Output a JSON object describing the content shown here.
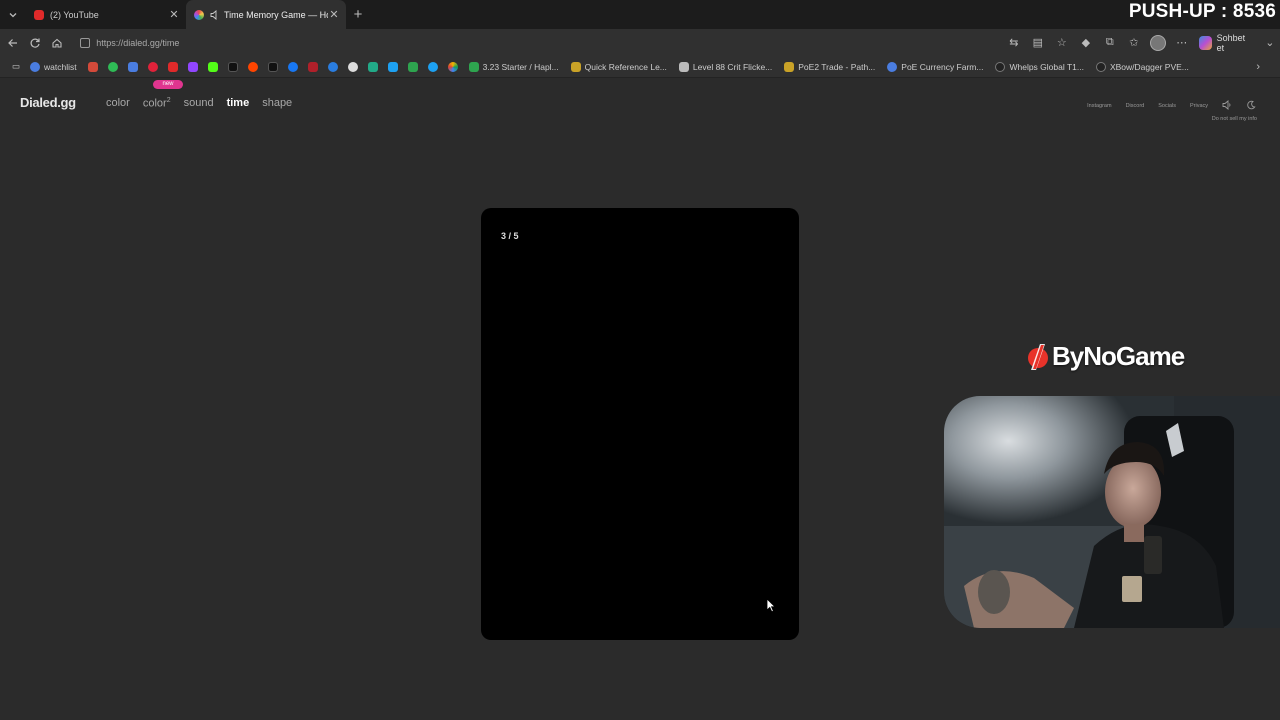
{
  "browser": {
    "tabs": [
      {
        "label": "(2) YouTube",
        "active": false,
        "fav_color": "#e02a2a"
      },
      {
        "label": "Time Memory Game — How ...",
        "active": true,
        "fav_color": "#3b8cf0"
      }
    ],
    "address": "https://dialed.gg/time",
    "copilot_label": "Sohbet et",
    "bookmarks": [
      {
        "label": "watchlist",
        "color": "#4a7de0"
      },
      {
        "label": "3.23 Starter / Hapl...",
        "color": "#2ea44f"
      },
      {
        "label": "Quick Reference Le...",
        "color": "#c9a227"
      },
      {
        "label": "Level 88 Crit Flicke...",
        "color": "#bbbbbb"
      },
      {
        "label": "PoE2 Trade - Path...",
        "color": "#c9a227"
      },
      {
        "label": "PoE Currency Farm...",
        "color": "#4a7de0"
      },
      {
        "label": "Whelps Global T1...",
        "color": "#222222"
      },
      {
        "label": "XBow/Dagger PVE...",
        "color": "#222222"
      }
    ],
    "bookmark_icons": [
      "#d44a3a",
      "#2fbb56",
      "#4a7de0",
      "#e0223a",
      "#e02a2a",
      "#9146ff",
      "#53fc18",
      "#111111",
      "#ff4500",
      "#111111",
      "#1877f2",
      "#e02a2a",
      "#2a7de0",
      "#111111",
      "#22aa88",
      "#1da1f2",
      "#2ea44f",
      "#1da1f2",
      "#f4b400"
    ]
  },
  "overlay": {
    "pushup": "PUSH-UP : 8536",
    "brand": "ByNoGame"
  },
  "site": {
    "logo": "Dialed.gg",
    "nav": {
      "color": "color",
      "color2": "color",
      "color2_sup": "2",
      "sound": "sound",
      "time": "time",
      "shape": "shape"
    },
    "new_badge": "new",
    "right_links": {
      "instagram": "Instagram",
      "discord": "Discord",
      "socials": "Socials",
      "privacy": "Privacy"
    },
    "dnsmi": "Do not sell my info"
  },
  "game": {
    "counter": "3 / 5"
  }
}
